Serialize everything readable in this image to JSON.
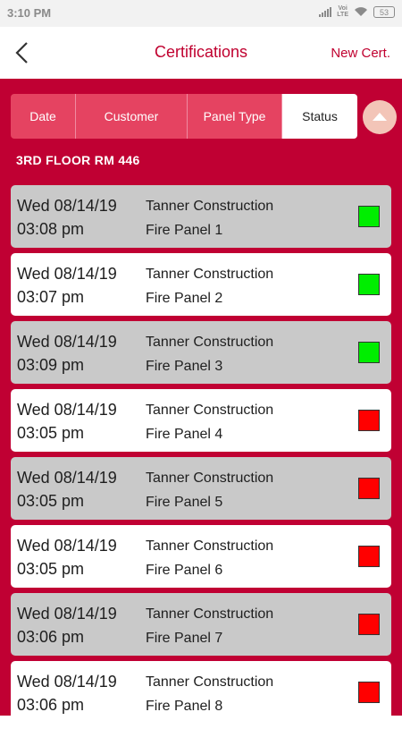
{
  "status_bar": {
    "time": "3:10 PM",
    "volte_line1": "Voi",
    "volte_line2": "LTE",
    "battery": "53"
  },
  "header": {
    "title": "Certifications",
    "new_cert": "New Cert."
  },
  "sort_tabs": [
    {
      "label": "Date",
      "active": false
    },
    {
      "label": "Customer",
      "active": false
    },
    {
      "label": "Panel Type",
      "active": false
    },
    {
      "label": "Status",
      "active": true
    }
  ],
  "group_label": "3RD FLOOR RM 446",
  "colors": {
    "ok": "#00ee00",
    "fail": "#ff0000",
    "brand": "#c00033"
  },
  "rows": [
    {
      "day": "Wed 08/14/19",
      "time": "03:08 pm",
      "customer": "Tanner Construction",
      "panel": "Fire Panel 1",
      "status": "ok"
    },
    {
      "day": "Wed 08/14/19",
      "time": "03:07 pm",
      "customer": "Tanner Construction",
      "panel": "Fire Panel 2",
      "status": "ok"
    },
    {
      "day": "Wed 08/14/19",
      "time": "03:09 pm",
      "customer": "Tanner Construction",
      "panel": "Fire Panel 3",
      "status": "ok"
    },
    {
      "day": "Wed 08/14/19",
      "time": "03:05 pm",
      "customer": "Tanner Construction",
      "panel": "Fire Panel 4",
      "status": "fail"
    },
    {
      "day": "Wed 08/14/19",
      "time": "03:05 pm",
      "customer": "Tanner Construction",
      "panel": "Fire Panel 5",
      "status": "fail"
    },
    {
      "day": "Wed 08/14/19",
      "time": "03:05 pm",
      "customer": "Tanner Construction",
      "panel": "Fire Panel 6",
      "status": "fail"
    },
    {
      "day": "Wed 08/14/19",
      "time": "03:06 pm",
      "customer": "Tanner Construction",
      "panel": "Fire Panel 7",
      "status": "fail"
    },
    {
      "day": "Wed 08/14/19",
      "time": "03:06 pm",
      "customer": "Tanner Construction",
      "panel": "Fire Panel 8",
      "status": "fail"
    }
  ]
}
